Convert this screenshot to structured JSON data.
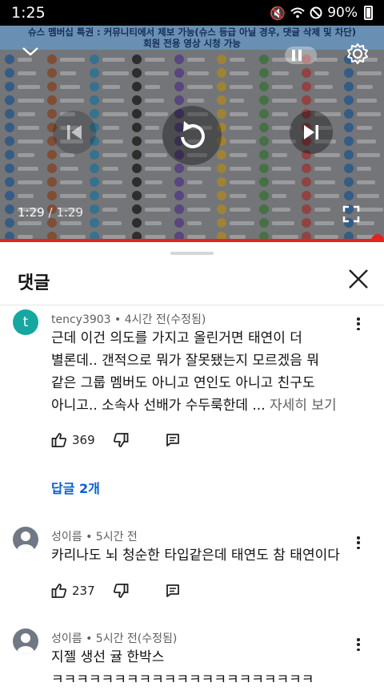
{
  "status_bar": {
    "time": "1:25",
    "battery": "90%"
  },
  "player": {
    "banner_line1": "슈스 멤버십 특권 : 커뮤니티에서 제보 가능(슈스 등급 아닐 경우, 댓글 삭제 및 차단)",
    "banner_line2": "회원 전용 영상 시청 가능",
    "current_time": "1:29",
    "separator": "/",
    "duration": "1:29",
    "progress": 1.0
  },
  "comments_sheet": {
    "title": "댓글",
    "comments": [
      {
        "avatar_letter": "t",
        "meta": "tency3903 • 4시간 전(수정됨)",
        "lines": [
          "근데 이건 의도를 가지고 올린거면 태연이 더",
          "별론데.. 갠적으로 뭐가 잘못됐는지 모르겠음 뭐",
          "같은 그룹 멤버도 아니고 연인도 아니고 친구도",
          "아니고.. 소속사 선배가 수두룩한데 ..."
        ],
        "more_label": "자세히 보기",
        "likes": "369",
        "replies_label": "답글 2개"
      },
      {
        "meta": "성이름 • 5시간 전",
        "lines": [
          "카리나도 뇌 청순한 타입같은데 태연도 참 태연이다"
        ],
        "likes": "237"
      },
      {
        "meta": "성이름 • 5시간 전(수정됨)",
        "lines": [
          "지젤 생선 귤 한박스",
          "ㅋㅋㅋㅋㅋㅋㅋㅋㅋㅋㅋㅋㅋㅋㅋㅋㅋㅋㅋㅋㅋ"
        ]
      }
    ]
  }
}
